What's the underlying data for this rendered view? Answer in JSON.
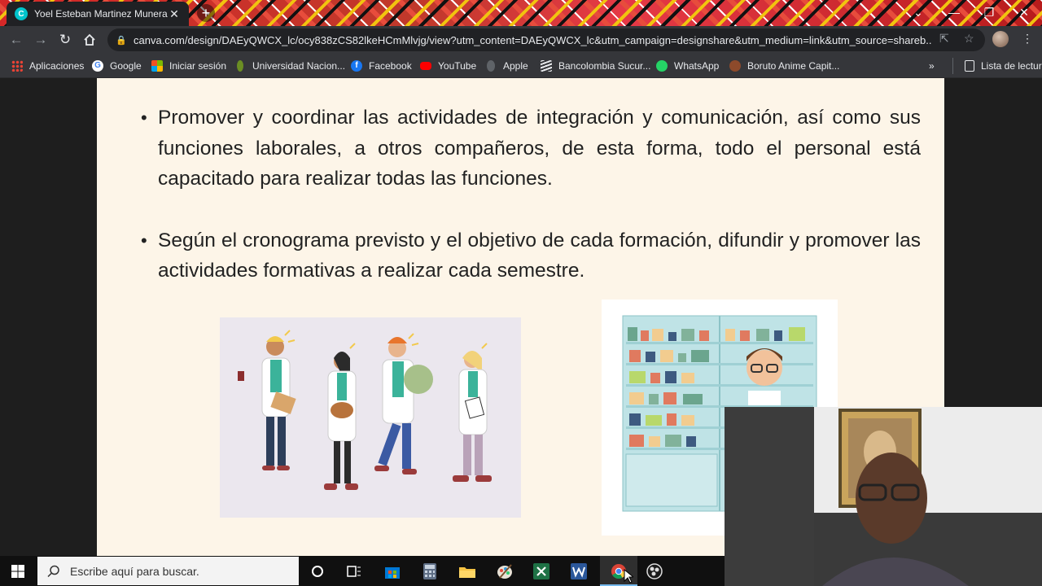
{
  "browser": {
    "tab_title": "Yoel Esteban Martinez Munera",
    "tab_close": "✕",
    "new_tab": "+",
    "url": "canva.com/design/DAEyQWCX_lc/ocy838zCS82lkeHCmMlvjg/view?utm_content=DAEyQWCX_lc&utm_campaign=designshare&utm_medium=link&utm_source=shareb...",
    "window_controls": {
      "dropdown": "⌄",
      "minimize": "—",
      "restore": "❐",
      "close": "✕"
    }
  },
  "bookmarks": [
    {
      "label": "Aplicaciones",
      "icon": "apps-grid-icon"
    },
    {
      "label": "Google",
      "icon": "google-icon"
    },
    {
      "label": "Iniciar sesión",
      "icon": "microsoft-icon"
    },
    {
      "label": "Universidad Nacion...",
      "icon": "university-icon"
    },
    {
      "label": "Facebook",
      "icon": "facebook-icon"
    },
    {
      "label": "YouTube",
      "icon": "youtube-icon"
    },
    {
      "label": "Apple",
      "icon": "apple-icon"
    },
    {
      "label": "Bancolombia Sucur...",
      "icon": "bancolombia-icon"
    },
    {
      "label": "WhatsApp",
      "icon": "whatsapp-icon"
    },
    {
      "label": "Boruto Anime Capit...",
      "icon": "boruto-icon"
    }
  ],
  "bookmarks_more": "»",
  "reading_list": "Lista de lectura",
  "slide": {
    "bullets": [
      "Promover y coordinar las actividades de integración y comunicación, así como sus funciones laborales, a otros compañeros, de esta forma, todo el personal está capacitado para realizar todas las funciones.",
      "Según el cronograma previsto y el objetivo de cada formación, difundir y promover las actividades formativas a realizar cada semestre."
    ]
  },
  "taskbar": {
    "search_placeholder": "Escribe aquí para buscar."
  },
  "colors": {
    "tab_strip": "#c0392b",
    "chrome_toolbar": "#35363a",
    "slide_bg": "#fdf5e8",
    "taskbar": "#101010"
  }
}
